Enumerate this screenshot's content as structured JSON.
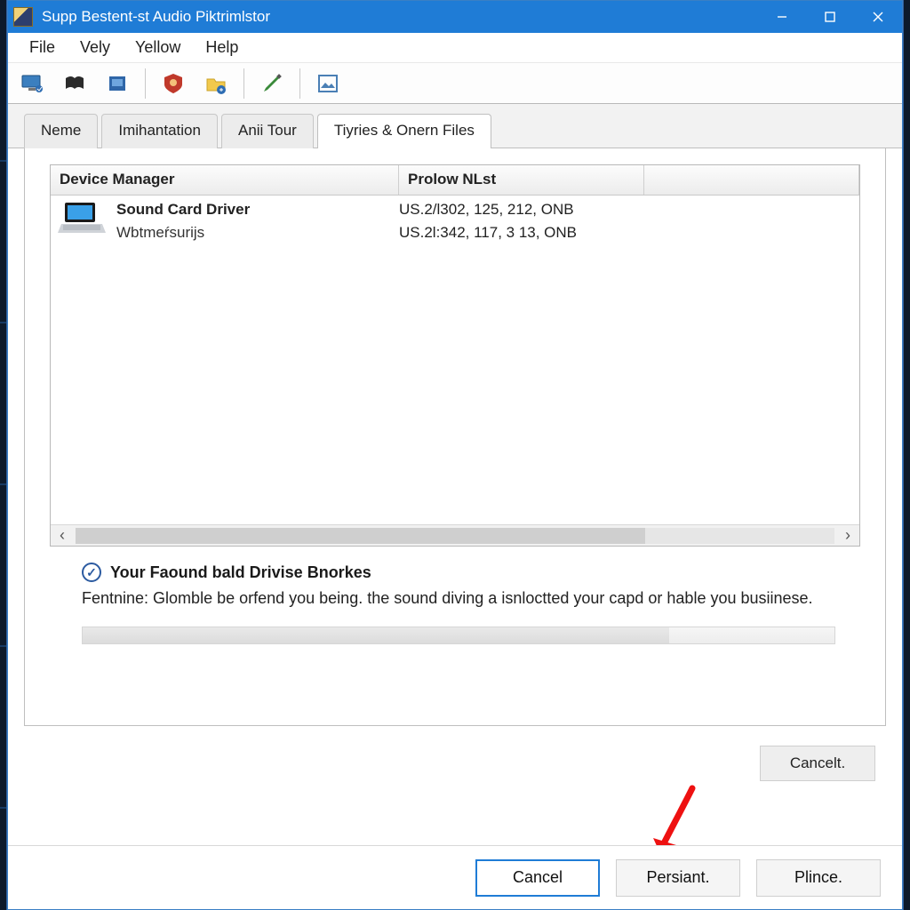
{
  "window": {
    "title": "Supp Bestent-st Audio Piktrimlstor"
  },
  "menu": {
    "items": [
      "File",
      "Vely",
      "Yellow",
      "Help"
    ]
  },
  "toolbar": {
    "icons": [
      "monitor-icon",
      "book-icon",
      "box-icon",
      "shield-icon",
      "folder-icon",
      "pen-icon",
      "picture-icon"
    ]
  },
  "tabs": {
    "items": [
      {
        "label": "Neme",
        "active": false
      },
      {
        "label": "Imihantation",
        "active": false
      },
      {
        "label": "Anii Tour",
        "active": false
      },
      {
        "label": "Tiyries & Onern Files",
        "active": true
      }
    ]
  },
  "table": {
    "headers": {
      "c1": "Device Manager",
      "c2": "Prolow NLst",
      "c3": ""
    },
    "rows": [
      {
        "name": "Sound Card Driver",
        "sub": "Wbtmeŕsurijs",
        "col2a": "US.2/l302, 125, 212, ONB",
        "col2b": "US.2l:342, 117, 3 13, ONB"
      }
    ]
  },
  "status": {
    "title": "Your Faound bald Drivise Bnorkes",
    "body": "Fentnine: Glomble be orfend you being. the sound diving a isnloctted your capd or hable you busiinese."
  },
  "buttons": {
    "cancel_upper": "Cancelt.",
    "cancel": "Cancel",
    "persiant": "Persiant.",
    "plince": "Plince."
  }
}
